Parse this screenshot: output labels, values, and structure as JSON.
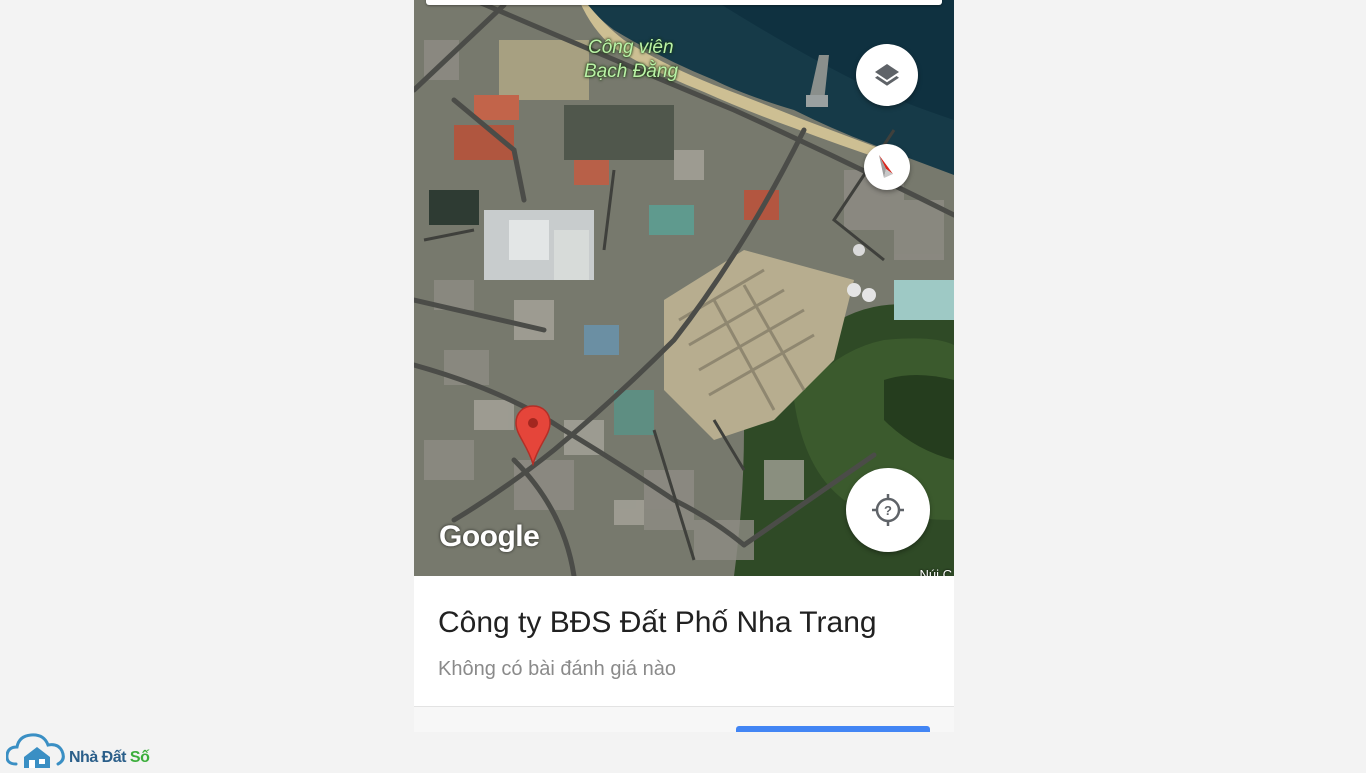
{
  "map": {
    "place_labels": [
      "Công viên",
      "Bạch Đằng"
    ],
    "attribution": "Google",
    "corner_text": "Núi C",
    "marker": "red-location-pin-icon",
    "controls": {
      "layers": "layers-icon",
      "compass": "compass-icon",
      "my_location": "my-location-question-icon"
    }
  },
  "place": {
    "title": "Công ty BĐS Đất Phố Nha Trang",
    "reviews": "Không có bài đánh giá nào"
  },
  "watermark": {
    "brand_main": "Nhà Đất",
    "brand_accent": "Số"
  },
  "colors": {
    "pin": "#e5453a",
    "action_button": "#4285f4",
    "brand_blue": "#2b5f8a",
    "brand_green": "#3cae3c"
  }
}
